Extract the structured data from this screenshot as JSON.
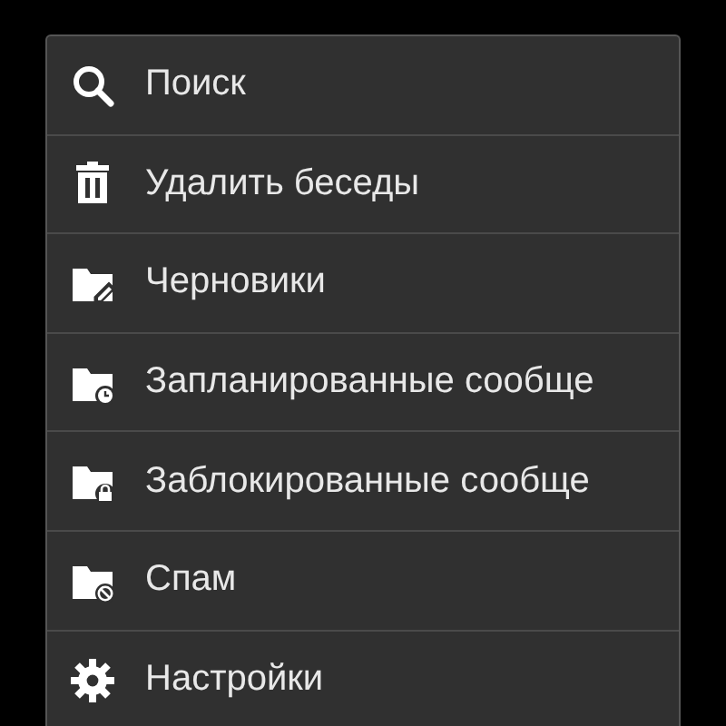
{
  "menu": {
    "items": [
      {
        "kind": "search",
        "label": "Поиск"
      },
      {
        "kind": "delete",
        "label": "Удалить беседы"
      },
      {
        "kind": "drafts",
        "label": "Черновики"
      },
      {
        "kind": "scheduled",
        "label": "Запланированные сообще"
      },
      {
        "kind": "blocked",
        "label": "Заблокированные сообще"
      },
      {
        "kind": "spam",
        "label": "Спам"
      },
      {
        "kind": "settings",
        "label": "Настройки"
      }
    ]
  }
}
